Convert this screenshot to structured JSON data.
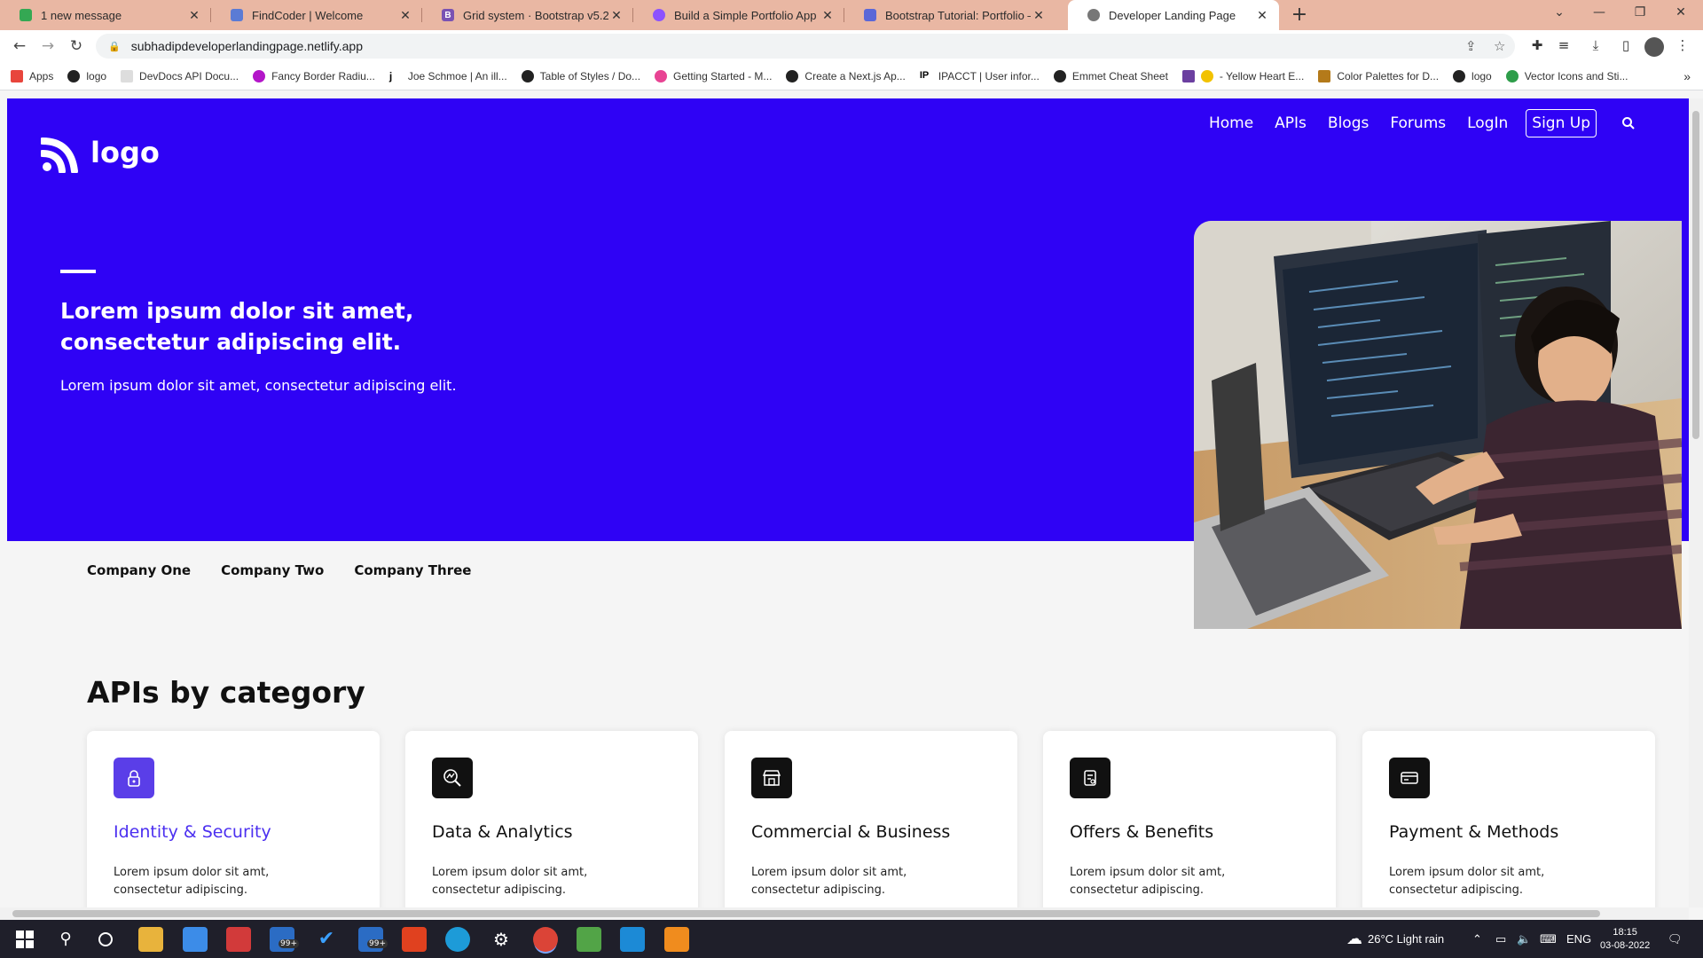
{
  "browser": {
    "tabs": [
      {
        "title": "1 new message",
        "favicon_color": "#34a853"
      },
      {
        "title": "FindCoder | Welcome",
        "favicon_color": "#5b7bd5"
      },
      {
        "title": "Grid system · Bootstrap v5.2",
        "favicon_color": "#7952b3"
      },
      {
        "title": "Build a Simple Portfolio App with",
        "favicon_color": "#8c52ff"
      },
      {
        "title": "Bootstrap Tutorial: Portfolio – les",
        "favicon_color": "#5a67d8"
      },
      {
        "title": "Developer Landing Page",
        "favicon_color": "#777777"
      }
    ],
    "url": "subhadipdeveloperlandingpage.netlify.app",
    "bookmarks": [
      "Apps",
      "logo",
      "DevDocs API Docu...",
      "Fancy Border Radiu...",
      "Joe Schmoe | An ill...",
      "Table of Styles / Do...",
      "Getting Started - M...",
      "Create a Next.js Ap...",
      "IPACCT | User infor...",
      "Emmet Cheat Sheet",
      "- Yellow Heart E...",
      "Color Palettes for D...",
      "logo",
      "Vector Icons and Sti..."
    ]
  },
  "page": {
    "brand": "logo",
    "nav": {
      "home": "Home",
      "apis": "APIs",
      "blogs": "Blogs",
      "forums": "Forums",
      "login": "LogIn",
      "signup": "Sign Up"
    },
    "hero": {
      "title": "Lorem ipsum dolor sit amet, consectetur adipiscing elit.",
      "subtitle": "Lorem ipsum dolor sit amet, consectetur adipiscing elit."
    },
    "companies": [
      "Company One",
      "Company Two",
      "Company Three"
    ],
    "section_title": "APIs by category",
    "cards": [
      {
        "title": "Identity & Security",
        "desc": "Lorem ipsum dolor sit amt, consectetur adipiscing.",
        "icon": "lock-icon"
      },
      {
        "title": "Data & Analytics",
        "desc": "Lorem ipsum dolor sit amt, consectetur adipiscing.",
        "icon": "analytics-icon"
      },
      {
        "title": "Commercial & Business",
        "desc": "Lorem ipsum dolor sit amt, consectetur adipiscing.",
        "icon": "store-icon"
      },
      {
        "title": "Offers & Benefits",
        "desc": "Lorem ipsum dolor sit amt, consectetur adipiscing.",
        "icon": "gift-icon"
      },
      {
        "title": "Payment & Methods",
        "desc": "Lorem ipsum dolor sit amt, consectetur adipiscing.",
        "icon": "card-icon"
      }
    ],
    "colors": {
      "hero_bg": "#2f02f5",
      "accent": "#4b2ff0"
    }
  },
  "taskbar": {
    "weather": "26°C  Light rain",
    "lang": "ENG",
    "time": "18:15",
    "date": "03-08-2022",
    "badge1": "99+",
    "badge2": "99+"
  }
}
